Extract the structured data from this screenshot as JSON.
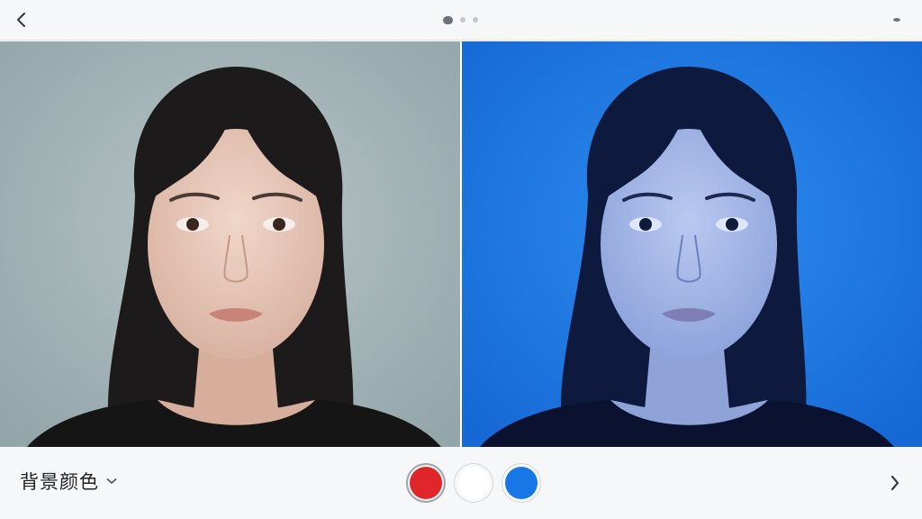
{
  "header": {
    "back_icon": "chevron-left-icon",
    "more_icon": "more-icon",
    "pager": {
      "count": 3,
      "active": 0
    }
  },
  "panels": {
    "original_background": "#a9b9bc",
    "preview_background": "#1f7fe6"
  },
  "footer": {
    "background_label": "背景颜色",
    "dropdown_icon": "chevron-down-icon",
    "next_icon": "chevron-right-icon",
    "swatches": [
      {
        "name": "red",
        "color": "#e0262a",
        "selected": true
      },
      {
        "name": "white",
        "color": "#ffffff",
        "selected": false
      },
      {
        "name": "blue",
        "color": "#1877e6",
        "selected": false
      }
    ]
  }
}
